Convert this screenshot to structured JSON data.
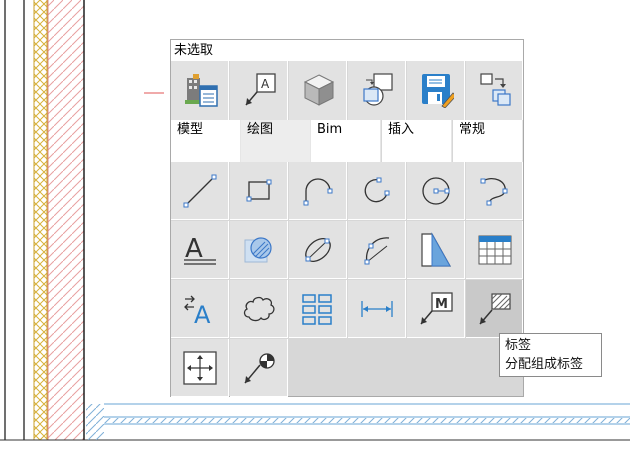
{
  "panel": {
    "title": "未选取",
    "categories": [
      {
        "label": "模型",
        "icon": "building-properties-icon"
      },
      {
        "label": "绘图",
        "icon": "draw-leader-icon"
      },
      {
        "label": "Bim",
        "icon": "cube-3d-icon"
      },
      {
        "label": "插入",
        "icon": "insert-block-icon"
      },
      {
        "label": "常规",
        "icon": "save-edit-icon"
      },
      {
        "label": "",
        "icon": "copy-move-icon"
      }
    ],
    "tools": [
      "line-icon",
      "rectangle-icon",
      "arc-icon",
      "circle-arc-icon",
      "circle-icon",
      "polyline-icon",
      "text-icon",
      "hatch-icon",
      "ellipse-icon",
      "arc-3point-icon",
      "wedge-icon",
      "table-icon",
      "text-align-icon",
      "revision-cloud-icon",
      "array-icon",
      "linear-dimension-icon",
      "multileader-m-icon",
      "label-group-icon",
      "move-crosshair-icon",
      "leader-point-icon"
    ]
  },
  "tooltip": {
    "title": "标签",
    "description": "分配组成标签"
  }
}
